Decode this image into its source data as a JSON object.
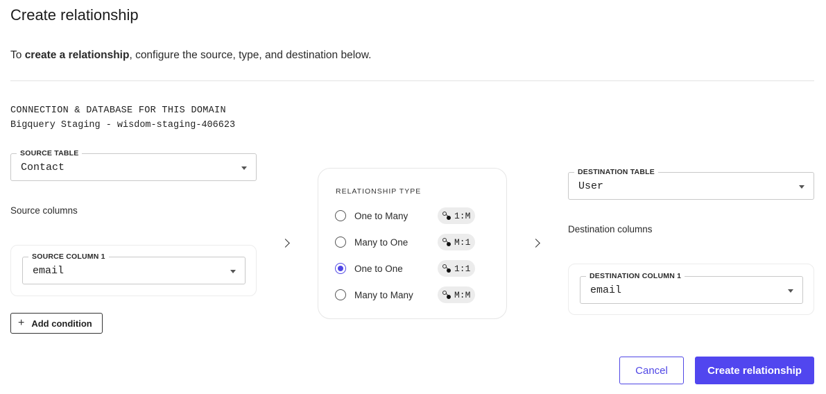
{
  "dialog": {
    "title": "Create relationship",
    "intro_prefix": "To ",
    "intro_bold": "create a relationship",
    "intro_suffix": ", configure the source, type, and destination below."
  },
  "connection": {
    "label": "CONNECTION & DATABASE FOR THIS DOMAIN",
    "value": "Bigquery Staging - wisdom-staging-406623"
  },
  "source": {
    "table_label": "SOURCE TABLE",
    "table_value": "Contact",
    "columns_label": "Source columns",
    "column_label": "SOURCE COLUMN 1",
    "column_value": "email",
    "add_condition": "Add condition"
  },
  "relationship": {
    "title": "RELATIONSHIP TYPE",
    "options": [
      {
        "label": "One to Many",
        "code": "1:M",
        "selected": false
      },
      {
        "label": "Many to One",
        "code": "M:1",
        "selected": false
      },
      {
        "label": "One to One",
        "code": "1:1",
        "selected": true
      },
      {
        "label": "Many to Many",
        "code": "M:M",
        "selected": false
      }
    ]
  },
  "destination": {
    "table_label": "DESTINATION TABLE",
    "table_value": "User",
    "columns_label": "Destination columns",
    "column_label": "DESTINATION COLUMN 1",
    "column_value": "email"
  },
  "actions": {
    "cancel": "Cancel",
    "create": "Create relationship"
  },
  "colors": {
    "accent": "#5146ef"
  },
  "icons": {
    "add": "plus-icon",
    "arrow": "chevron-right-icon",
    "dropdown": "caret-down-icon",
    "relationship": "relationship-icon"
  }
}
